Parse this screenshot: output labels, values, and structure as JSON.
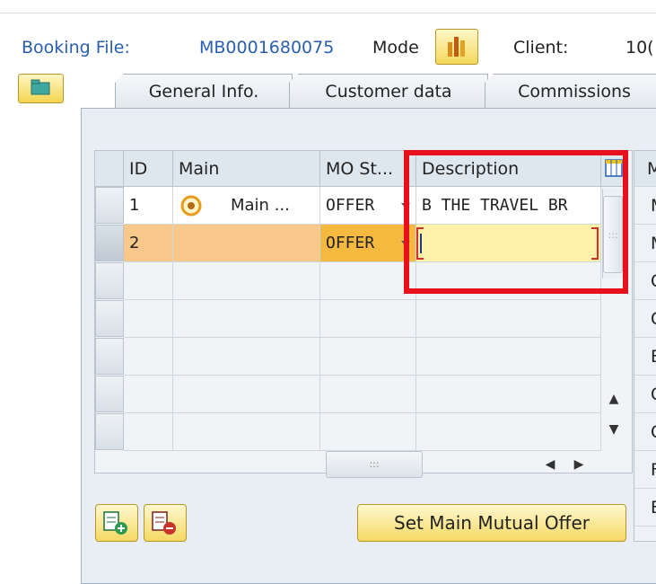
{
  "header": {
    "booking_label": "Booking File:",
    "booking_value": "MB0001680075",
    "mode_label": "Mode",
    "mode_icon": "bar-chart-icon",
    "client_label": "Client:",
    "client_value": "10("
  },
  "toolbar": {
    "folder_icon": "folder-icon"
  },
  "tabs": [
    {
      "label": "General Info."
    },
    {
      "label": "Customer data"
    },
    {
      "label": "Commissions"
    }
  ],
  "grid": {
    "columns": [
      "ID",
      "Main",
      "MO St...",
      "Description"
    ],
    "rows": [
      {
        "id": "1",
        "main": "Main ...",
        "mo_status": "OFFER",
        "description": "B THE TRAVEL BR"
      },
      {
        "id": "2",
        "main": "",
        "mo_status": "OFFER",
        "description": ""
      }
    ],
    "right_column_header": "M",
    "right_column_cells": [
      "M",
      "M",
      "C",
      "C",
      "E",
      "C",
      "C",
      "F",
      "E"
    ]
  },
  "buttons": {
    "set_main": "Set Main Mutual Offer",
    "add_row_icon": "add-row-icon",
    "delete_row_icon": "delete-row-icon"
  },
  "colors": {
    "link_blue": "#2a5fb0",
    "highlight_red": "#e8101a",
    "selected_row": "#f8c88a",
    "button_yellow": "#f4d963"
  }
}
